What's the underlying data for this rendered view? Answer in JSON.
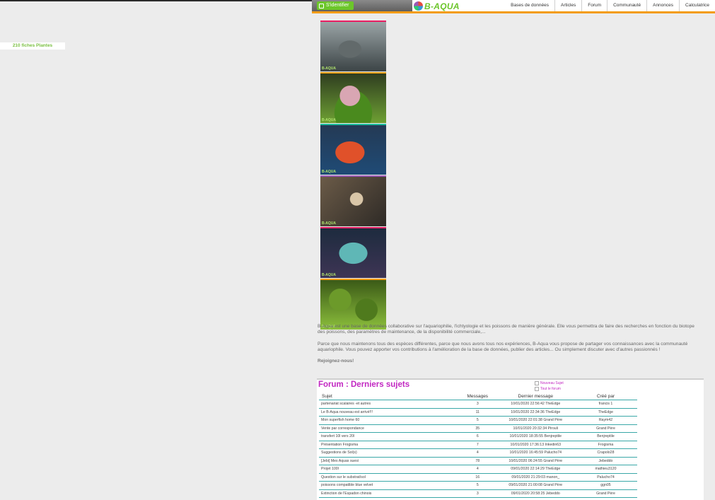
{
  "header": {
    "login_label": "S'identifier",
    "logo_text": "B-AQUA",
    "nav": [
      "Bases de données",
      "Articles",
      "Forum",
      "Communauté",
      "Annonces",
      "Calculatrice"
    ]
  },
  "sidebar": {
    "label": "210 fiches Plantes"
  },
  "thumbnails": {
    "watermark": "B-AQUA",
    "count": 6
  },
  "intro": {
    "p1": "B-Aqua est une base de données collaborative sur l'aquariophilie, l'ichtyologie et les poissons de manière générale. Elle vous permettra de faire des recherches en fonction du biotope des poissons, des paramètres de maintenance, de la disponibilité commerciale,...",
    "p2": "Parce que nous maintenons tous des espèces différentes, parce que nous avons tous nos expériences, B-Aqua vous propose de partager vos connaissances avec la communauté aquariophile. Vous pouvez apporter vos contributions à l'amélioration de la base de données, publier des articles... Ou simplement discuter avec d'autres passionnés !",
    "join": "Rejoignez-nous!"
  },
  "forum": {
    "title": "Forum : Derniers sujets",
    "new_topic": "Nouveau Sujet",
    "all_forum": "Tout le forum",
    "columns": {
      "subject": "Sujet",
      "messages": "Messages",
      "last": "Dernier message",
      "created": "Créé par"
    },
    "rows": [
      {
        "subject": "partenariat scalaires -et autres",
        "messages": "3",
        "last": "10/01/2020 22:56:42 TheEdge",
        "by": "francis 1"
      },
      {
        "subject": "Le B-Aqua nouveau est arrivé!!!",
        "messages": "11",
        "last": "10/01/2020 22:34:36 TheEdge",
        "by": "TheEdge"
      },
      {
        "subject": "Mon superfish home 60",
        "messages": "5",
        "last": "10/01/2020 22:01:38 Grand Père",
        "by": "Raym42"
      },
      {
        "subject": "Vente par correspondance",
        "messages": "35",
        "last": "10/01/2020 20:32:34 Pirouli",
        "by": "Grand Père"
      },
      {
        "subject": "transfert 10l vers 20l",
        "messages": "6",
        "last": "10/01/2020 18:35:55 Benjreptile",
        "by": "Benjreptile"
      },
      {
        "subject": "Présentation Frogisma",
        "messages": "7",
        "last": "10/01/2020 17:36:13 Inkedin63",
        "by": "Frogisma"
      },
      {
        "subject": "Suggestions de Sol(s)",
        "messages": "4",
        "last": "10/01/2020 16:45:59 Palucho74",
        "by": "Crapolo28"
      },
      {
        "subject": "[Jebi] Mes Aquas suesi",
        "messages": "78",
        "last": "10/01/2020 06:24:55 Grand Père",
        "by": "Jebeddo"
      },
      {
        "subject": "Projet 100l",
        "messages": "4",
        "last": "09/01/2020 22:14:29 TheEdge",
        "by": "mathieu3120"
      },
      {
        "subject": "Question sur le substrat/sol",
        "messages": "16",
        "last": "09/01/2020 21:29:03 manon_",
        "by": "Palucho74"
      },
      {
        "subject": "poissons compatible blue velvet",
        "messages": "5",
        "last": "09/01/2020 21:00:08 Grand Père",
        "by": "ggn05"
      },
      {
        "subject": "Extinction de l'Espadon chinois",
        "messages": "3",
        "last": "09/01/2020 20:58:25 Jebeddo",
        "by": "Grand Père"
      }
    ]
  }
}
